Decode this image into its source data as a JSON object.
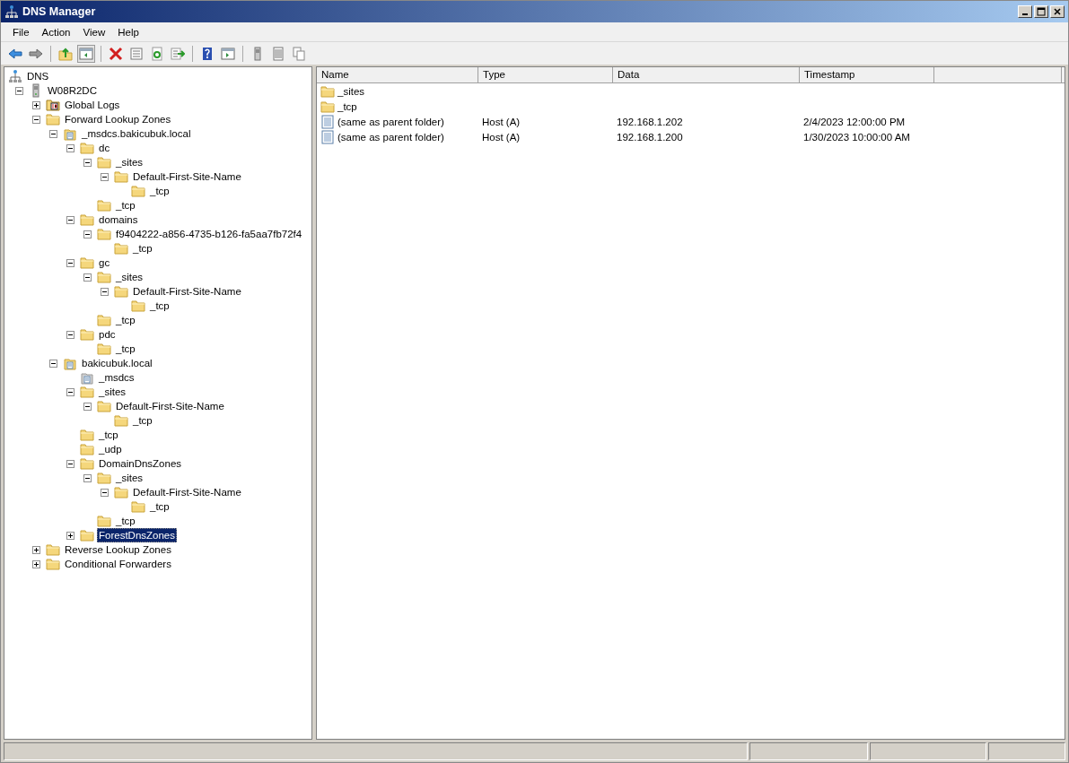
{
  "window": {
    "title": "DNS Manager"
  },
  "menu": [
    "File",
    "Action",
    "View",
    "Help"
  ],
  "tree": {
    "label": "DNS",
    "kind": "dns",
    "selected": false,
    "children": [
      {
        "label": "W08R2DC",
        "kind": "server",
        "expanded": true,
        "selected": false,
        "children": [
          {
            "label": "Global Logs",
            "kind": "log",
            "expanded": false,
            "selected": false
          },
          {
            "label": "Forward Lookup Zones",
            "kind": "folder",
            "expanded": true,
            "selected": false,
            "children": [
              {
                "label": "_msdcs.bakicubuk.local",
                "kind": "zone",
                "expanded": true,
                "selected": false,
                "children": [
                  {
                    "label": "dc",
                    "kind": "folder",
                    "expanded": true,
                    "selected": false,
                    "children": [
                      {
                        "label": "_sites",
                        "kind": "folder",
                        "expanded": true,
                        "selected": false,
                        "children": [
                          {
                            "label": "Default-First-Site-Name",
                            "kind": "folder",
                            "expanded": true,
                            "selected": false,
                            "children": [
                              {
                                "label": "_tcp",
                                "kind": "folder",
                                "selected": false
                              }
                            ]
                          }
                        ]
                      },
                      {
                        "label": "_tcp",
                        "kind": "folder",
                        "selected": false
                      }
                    ]
                  },
                  {
                    "label": "domains",
                    "kind": "folder",
                    "expanded": true,
                    "selected": false,
                    "children": [
                      {
                        "label": "f9404222-a856-4735-b126-fa5aa7fb72f4",
                        "kind": "folder",
                        "expanded": true,
                        "selected": false,
                        "children": [
                          {
                            "label": "_tcp",
                            "kind": "folder",
                            "selected": false
                          }
                        ]
                      }
                    ]
                  },
                  {
                    "label": "gc",
                    "kind": "folder",
                    "expanded": true,
                    "selected": false,
                    "children": [
                      {
                        "label": "_sites",
                        "kind": "folder",
                        "expanded": true,
                        "selected": false,
                        "children": [
                          {
                            "label": "Default-First-Site-Name",
                            "kind": "folder",
                            "expanded": true,
                            "selected": false,
                            "children": [
                              {
                                "label": "_tcp",
                                "kind": "folder",
                                "selected": false
                              }
                            ]
                          }
                        ]
                      },
                      {
                        "label": "_tcp",
                        "kind": "folder",
                        "selected": false
                      }
                    ]
                  },
                  {
                    "label": "pdc",
                    "kind": "folder",
                    "expanded": true,
                    "selected": false,
                    "children": [
                      {
                        "label": "_tcp",
                        "kind": "folder",
                        "selected": false
                      }
                    ]
                  }
                ]
              },
              {
                "label": "bakicubuk.local",
                "kind": "zone",
                "expanded": true,
                "selected": false,
                "children": [
                  {
                    "label": "_msdcs",
                    "kind": "delegation",
                    "selected": false
                  },
                  {
                    "label": "_sites",
                    "kind": "folder",
                    "expanded": true,
                    "selected": false,
                    "children": [
                      {
                        "label": "Default-First-Site-Name",
                        "kind": "folder",
                        "expanded": true,
                        "selected": false,
                        "children": [
                          {
                            "label": "_tcp",
                            "kind": "folder",
                            "selected": false
                          }
                        ]
                      }
                    ]
                  },
                  {
                    "label": "_tcp",
                    "kind": "folder",
                    "selected": false
                  },
                  {
                    "label": "_udp",
                    "kind": "folder",
                    "selected": false
                  },
                  {
                    "label": "DomainDnsZones",
                    "kind": "folder",
                    "expanded": true,
                    "selected": false,
                    "children": [
                      {
                        "label": "_sites",
                        "kind": "folder",
                        "expanded": true,
                        "selected": false,
                        "children": [
                          {
                            "label": "Default-First-Site-Name",
                            "kind": "folder",
                            "expanded": true,
                            "selected": false,
                            "children": [
                              {
                                "label": "_tcp",
                                "kind": "folder",
                                "selected": false
                              }
                            ]
                          }
                        ]
                      },
                      {
                        "label": "_tcp",
                        "kind": "folder",
                        "selected": false
                      }
                    ]
                  },
                  {
                    "label": "ForestDnsZones",
                    "kind": "folder",
                    "expanded": false,
                    "selected": true
                  }
                ]
              }
            ]
          },
          {
            "label": "Reverse Lookup Zones",
            "kind": "folder",
            "expanded": false,
            "selected": false
          },
          {
            "label": "Conditional Forwarders",
            "kind": "folder",
            "expanded": false,
            "selected": false
          }
        ]
      }
    ]
  },
  "table": {
    "columns": [
      "Name",
      "Type",
      "Data",
      "Timestamp"
    ],
    "rows": [
      {
        "kind": "folder",
        "name": "_sites"
      },
      {
        "kind": "folder",
        "name": "_tcp"
      },
      {
        "kind": "record",
        "name": "(same as parent folder)",
        "type": "Host (A)",
        "data": "192.168.1.202",
        "timestamp": "2/4/2023 12:00:00 PM"
      },
      {
        "kind": "record",
        "name": "(same as parent folder)",
        "type": "Host (A)",
        "data": "192.168.1.200",
        "timestamp": "1/30/2023 10:00:00 AM"
      }
    ]
  }
}
